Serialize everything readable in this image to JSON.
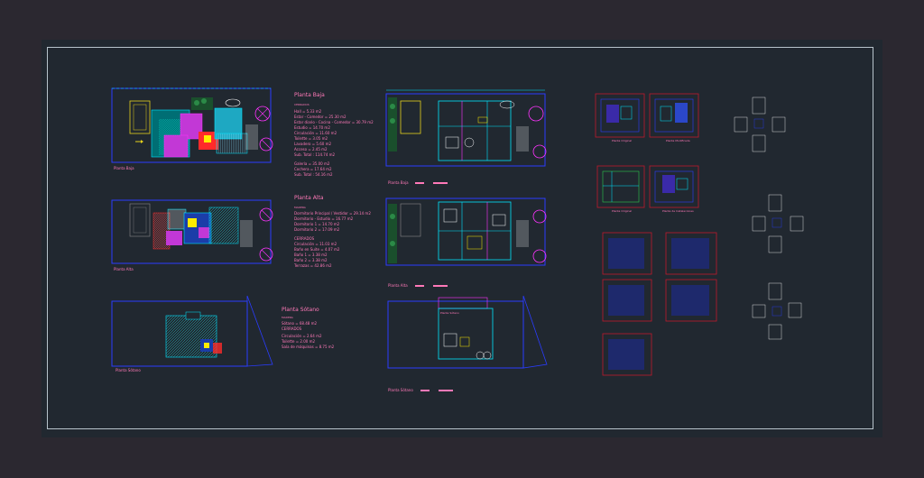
{
  "colors": {
    "background": "#2b2830",
    "viewport": "#212830",
    "frame": "#b8c4cc",
    "text_accent": "#ff79b8",
    "line_blue": "#2a3cff",
    "line_cyan": "#00e5ff",
    "line_magenta": "#ff33ff",
    "hatch_teal": "#00b3a6",
    "hatch_red": "#ff2a2a",
    "sheet_border": "#c0182b"
  },
  "plans": {
    "planta_baja": {
      "title": "Planta Baja",
      "caption": "Planta Baja",
      "section": "CERRADOS",
      "lines": [
        "Hall = 5.33 m2",
        "Estar - Comedor = 25.30 m2",
        "Estar diario - Cocina - Comedor = 30.79 m2",
        "Estudio = 14.70 m2",
        "Circulación = 11.60 m2",
        "Toilette = 3.05 m2",
        "Lavadero = 5.60 m2",
        "Acceso = 2.45 m2",
        "Sub. Total : 114.74 m2"
      ],
      "section2_lines": [
        "Galería = 35.00 m2",
        "Cochera = 17.64 m2",
        "Sub. Total : 54.16 m2"
      ]
    },
    "planta_alta": {
      "title": "Planta Alta",
      "caption": "Planta Alta",
      "section": "MADERA",
      "lines": [
        "Dormitorio Principal / Vestidor = 29.14 m2",
        "Dormitorio - Estudio = 16.77 m2",
        "Dormitorio 1 = 14.70 m2",
        "Dormitorio 2 = 17.09 m2"
      ],
      "section2": "CERRADOS",
      "section2_lines": [
        "Circulación = 11.03 m2",
        "Baño en Suite = 4.07 m2",
        "Baño 1 = 3.38 m2",
        "Baño 2 = 3.38 m2",
        "Terrazas = 42.86 m2"
      ]
    },
    "planta_sotano": {
      "title": "Planta Sótano",
      "caption": "Planta Sótano",
      "section": "MADERA",
      "lines": [
        "Sótano = 68.48 m2"
      ],
      "section2": "CERRADOS",
      "section2_lines": [
        "Circulación = 2.64 m2",
        "Toilette = 2.00 m2",
        "Sala de máquinas = 8.75 m2"
      ]
    },
    "furnished": {
      "baja_caption": "Planta Baja",
      "alta_caption": "Planta Alta",
      "sotano_caption": "Planta Sótano"
    },
    "details": {
      "sheet1_caption": "Planta Original",
      "sheet2_caption": "Planta Modificada",
      "sheet3_caption": "Planta Original",
      "sheet4_caption": "Planta de Instalaciones"
    }
  }
}
